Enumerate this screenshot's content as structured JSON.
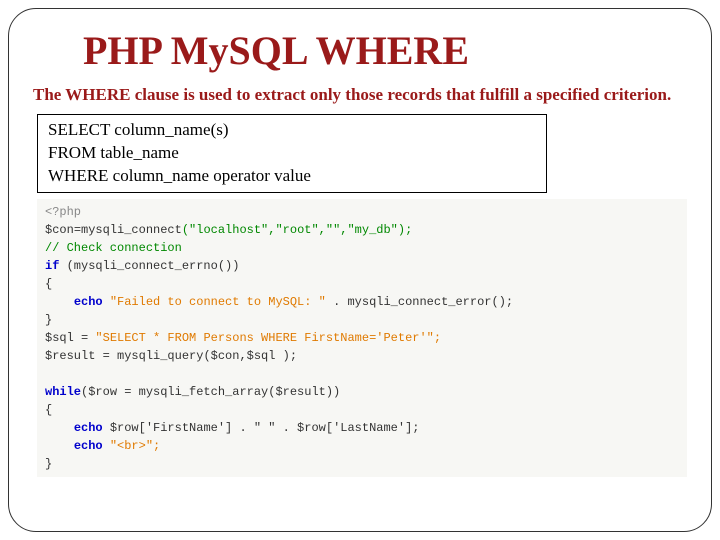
{
  "title": "PHP MySQL WHERE",
  "description": "The WHERE clause is used to extract only those records that fulfill a specified criterion.",
  "syntax": {
    "line1": "SELECT column_name(s)",
    "line2": "FROM table_name",
    "line3": "WHERE column_name operator value"
  },
  "code": {
    "open_tag": "<?php",
    "con_var": "$con",
    "eq": "=",
    "connect_fn": "mysqli_connect",
    "connect_args": "(\"localhost\",\"root\",\"\",\"my_db\");",
    "comment": "// Check connection",
    "if_kw": "if",
    "errno": " (mysqli_connect_errno())",
    "brace_open": "{",
    "echo_kw": "echo",
    "fail_str": " \"Failed to connect to MySQL: \" ",
    "concat_err": ". mysqli_connect_error();",
    "brace_close": "}",
    "sql_var": "$sql",
    "sql_assign": " = ",
    "sql_str": "\"SELECT * FROM Persons WHERE FirstName='Peter'\";",
    "result_var": "$result",
    "query_assign": " = mysqli_query($con,$sql );",
    "while_kw": "while",
    "while_cond": "($row = mysqli_fetch_array($result))",
    "row_first": " $row['FirstName'] . \" \" . $row['LastName'];",
    "br_str": " \"<br>\";"
  }
}
